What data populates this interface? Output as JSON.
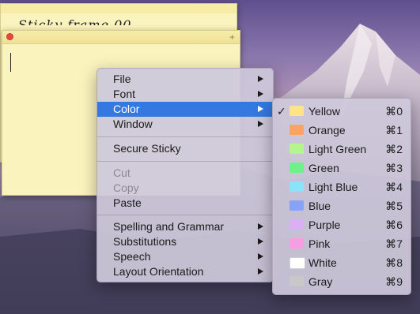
{
  "sticky_back": {
    "text": "Sticky frame 00"
  },
  "sticky_front": {
    "plus": "+"
  },
  "menu": {
    "items": [
      {
        "label": "File",
        "submenu": true,
        "enabled": true
      },
      {
        "label": "Font",
        "submenu": true,
        "enabled": true
      },
      {
        "label": "Color",
        "submenu": true,
        "enabled": true,
        "highlighted": true
      },
      {
        "label": "Window",
        "submenu": true,
        "enabled": true
      },
      {
        "label": "Secure Sticky",
        "submenu": false,
        "enabled": true
      },
      {
        "label": "Cut",
        "submenu": false,
        "enabled": false
      },
      {
        "label": "Copy",
        "submenu": false,
        "enabled": false
      },
      {
        "label": "Paste",
        "submenu": false,
        "enabled": true
      },
      {
        "label": "Spelling and Grammar",
        "submenu": true,
        "enabled": true
      },
      {
        "label": "Substitutions",
        "submenu": true,
        "enabled": true
      },
      {
        "label": "Speech",
        "submenu": true,
        "enabled": true
      },
      {
        "label": "Layout Orientation",
        "submenu": true,
        "enabled": true
      }
    ]
  },
  "color_menu": {
    "checkmark": "✓",
    "items": [
      {
        "label": "Yellow",
        "shortcut": "⌘0",
        "color": "#fde48a",
        "checked": true
      },
      {
        "label": "Orange",
        "shortcut": "⌘1",
        "color": "#f9a464",
        "checked": false
      },
      {
        "label": "Light Green",
        "shortcut": "⌘2",
        "color": "#b4f58c",
        "checked": false
      },
      {
        "label": "Green",
        "shortcut": "⌘3",
        "color": "#6ef08a",
        "checked": false
      },
      {
        "label": "Light Blue",
        "shortcut": "⌘4",
        "color": "#8be3f7",
        "checked": false
      },
      {
        "label": "Blue",
        "shortcut": "⌘5",
        "color": "#86a3f5",
        "checked": false
      },
      {
        "label": "Purple",
        "shortcut": "⌘6",
        "color": "#d9b0f3",
        "checked": false
      },
      {
        "label": "Pink",
        "shortcut": "⌘7",
        "color": "#f59ee1",
        "checked": false
      },
      {
        "label": "White",
        "shortcut": "⌘8",
        "color": "#ffffff",
        "checked": false
      },
      {
        "label": "Gray",
        "shortcut": "⌘9",
        "color": "#c8c8c8",
        "checked": false
      }
    ]
  }
}
